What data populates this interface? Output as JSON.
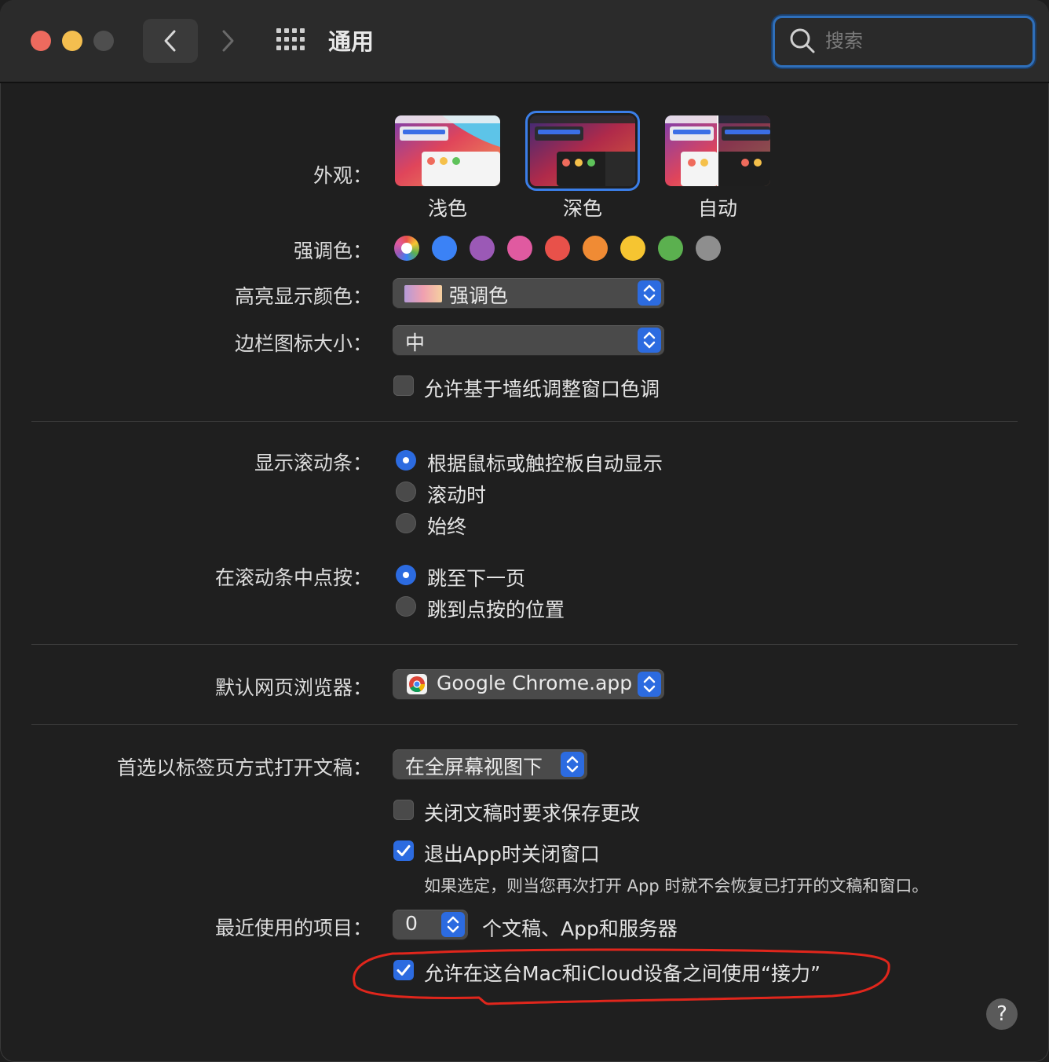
{
  "window": {
    "title": "通用"
  },
  "search": {
    "placeholder": "搜索"
  },
  "appearance": {
    "label": "外观：",
    "options": [
      "浅色",
      "深色",
      "自动"
    ],
    "selected": "深色"
  },
  "accent": {
    "label": "强调色：",
    "colors": [
      "#3b82f6",
      "#9b59b6",
      "#e05aa0",
      "#e8514a",
      "#f08b34",
      "#f6c531",
      "#5bb04f",
      "#8e8e8e"
    ]
  },
  "highlight": {
    "label": "高亮显示颜色：",
    "value": "强调色"
  },
  "sidebar_icon": {
    "label": "边栏图标大小：",
    "value": "中"
  },
  "wallpaper_tint": {
    "label": "允许基于墙纸调整窗口色调",
    "checked": false
  },
  "scrollbars": {
    "label": "显示滚动条：",
    "options": [
      "根据鼠标或触控板自动显示",
      "滚动时",
      "始终"
    ],
    "selected": 0
  },
  "scroll_click": {
    "label": "在滚动条中点按：",
    "options": [
      "跳至下一页",
      "跳到点按的位置"
    ],
    "selected": 0
  },
  "browser": {
    "label": "默认网页浏览器：",
    "value": "Google Chrome.app"
  },
  "tabs": {
    "label": "首选以标签页方式打开文稿：",
    "value": "在全屏幕视图下"
  },
  "ask_save": {
    "label": "关闭文稿时要求保存更改",
    "checked": false
  },
  "close_windows": {
    "label": "退出App时关闭窗口",
    "checked": true,
    "note": "如果选定，则当您再次打开 App 时就不会恢复已打开的文稿和窗口。"
  },
  "recent": {
    "label": "最近使用的项目：",
    "value": "0",
    "suffix": "个文稿、App和服务器"
  },
  "handoff": {
    "label": "允许在这台Mac和iCloud设备之间使用“接力”",
    "checked": true
  },
  "help": {
    "label": "?"
  }
}
